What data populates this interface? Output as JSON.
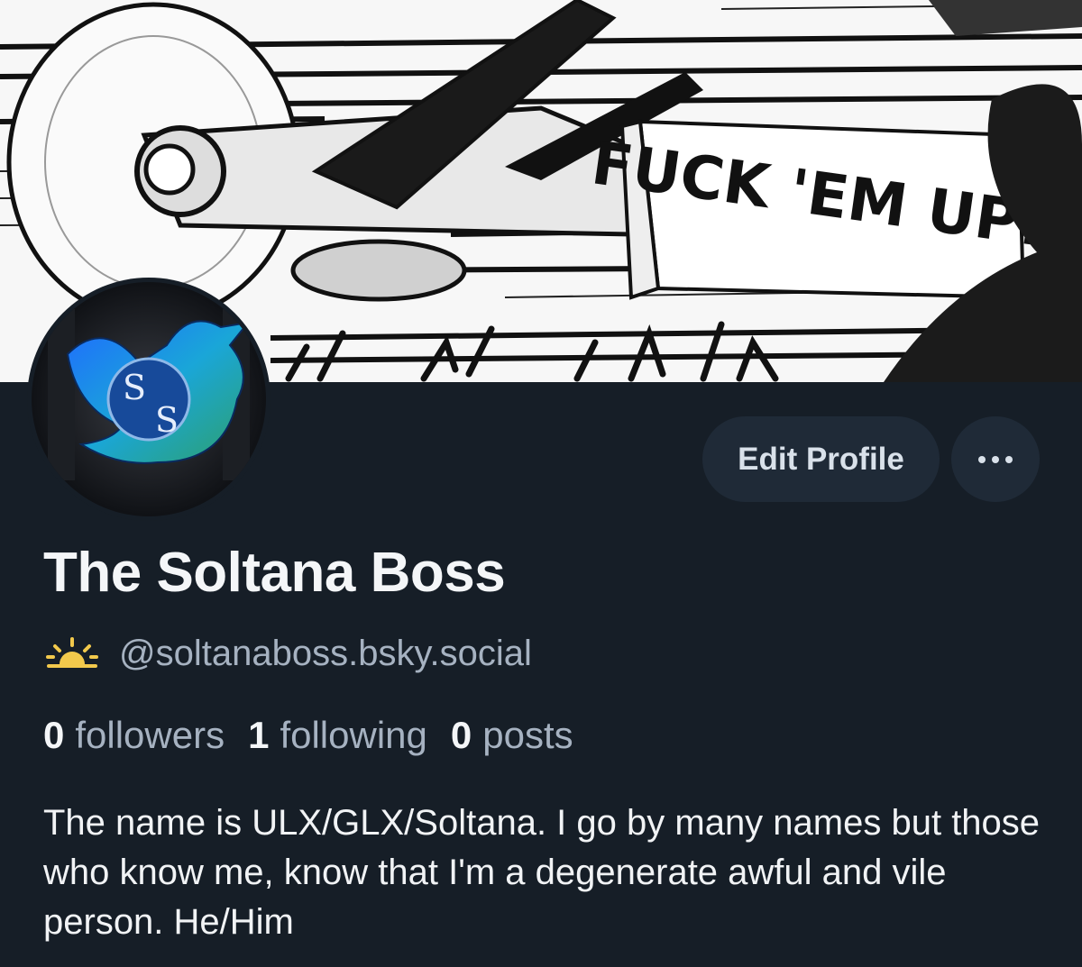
{
  "banner": {
    "text": "FUCK 'EM UP!!"
  },
  "profile": {
    "display_name": "The Soltana Boss",
    "handle": "@soltanaboss.bsky.social",
    "edit_label": "Edit Profile",
    "more_icon": "ellipsis-icon",
    "handle_icon": "sunrise-icon",
    "avatar_text": "S S"
  },
  "stats": [
    {
      "value": "0",
      "label": "followers"
    },
    {
      "value": "1",
      "label": "following"
    },
    {
      "value": "0",
      "label": "posts"
    }
  ],
  "bio": "The name is ULX/GLX/Soltana. I go by many names but those who know me, know that I'm a degenerate awful and vile person. He/Him",
  "colors": {
    "background": "#161e27",
    "button_bg": "#1f2a37",
    "muted_text": "#a6b2c1",
    "accent_yellow": "#f2c94c"
  }
}
